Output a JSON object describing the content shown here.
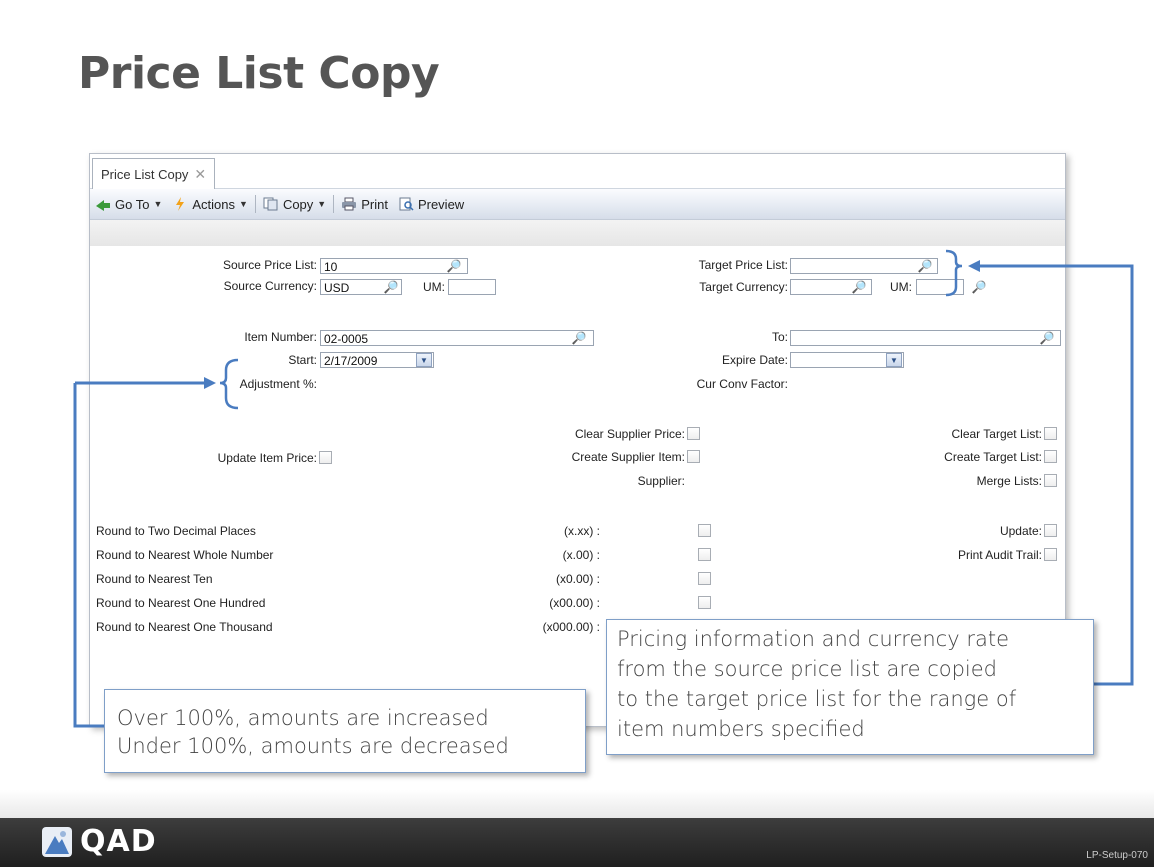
{
  "slide": {
    "title": "Price List Copy",
    "code": "LP-Setup-070"
  },
  "window": {
    "tab_label": "Price List Copy",
    "tab_close": "✕",
    "toolbar": {
      "goto": "Go To",
      "actions": "Actions",
      "copy": "Copy",
      "print": "Print",
      "preview": "Preview"
    }
  },
  "form": {
    "source_price_list": {
      "label": "Source Price List:",
      "value": "10"
    },
    "source_currency": {
      "label": "Source Currency:",
      "value": "USD"
    },
    "um": {
      "label": "UM:",
      "value": ""
    },
    "target_price_list": {
      "label": "Target Price List:",
      "value": ""
    },
    "target_currency": {
      "label": "Target Currency:",
      "value": ""
    },
    "target_um": {
      "label": "UM:",
      "value": ""
    },
    "item_number": {
      "label": "Item Number:",
      "value": "02-0005"
    },
    "to": {
      "label": "To:",
      "value": ""
    },
    "start": {
      "label": "Start:",
      "value": "2/17/2009"
    },
    "expire_date": {
      "label": "Expire Date:",
      "value": ""
    },
    "adjustment": {
      "label": "Adjustment %:"
    },
    "cur_conv_factor": {
      "label": "Cur Conv Factor:"
    },
    "clear_supplier_price": {
      "label": "Clear Supplier Price:"
    },
    "create_supplier_item": {
      "label": "Create Supplier Item:"
    },
    "supplier": {
      "label": "Supplier:"
    },
    "update_item_price": {
      "label": "Update Item Price:"
    },
    "clear_target_list": {
      "label": "Clear Target List:"
    },
    "create_target_list": {
      "label": "Create Target List:"
    },
    "merge_lists": {
      "label": "Merge Lists:"
    },
    "rounding": [
      {
        "label": "Round to Two Decimal Places",
        "format": "(x.xx) :"
      },
      {
        "label": "Round to Nearest Whole Number",
        "format": "(x.00) :"
      },
      {
        "label": "Round to Nearest Ten",
        "format": "(x0.00) :"
      },
      {
        "label": "Round to Nearest One Hundred",
        "format": "(x00.00) :"
      },
      {
        "label": "Round to Nearest One Thousand",
        "format": "(x000.00) :"
      }
    ],
    "update": {
      "label": "Update:"
    },
    "print_audit_trail": {
      "label": "Print Audit Trail:"
    }
  },
  "callouts": {
    "adjustment": {
      "line1": "Over 100%, amounts are increased",
      "line2": "Under 100%, amounts are decreased"
    },
    "copy": {
      "line1": "Pricing information and currency rate",
      "line2": "from the source price list are copied",
      "line3": "to the target price list for the range of",
      "line4": "item numbers specified"
    }
  },
  "footer": {
    "logo_text": "QAD"
  },
  "colors": {
    "accent": "#4a7cc0",
    "footer": "#2a2a2a",
    "title": "#555555"
  }
}
